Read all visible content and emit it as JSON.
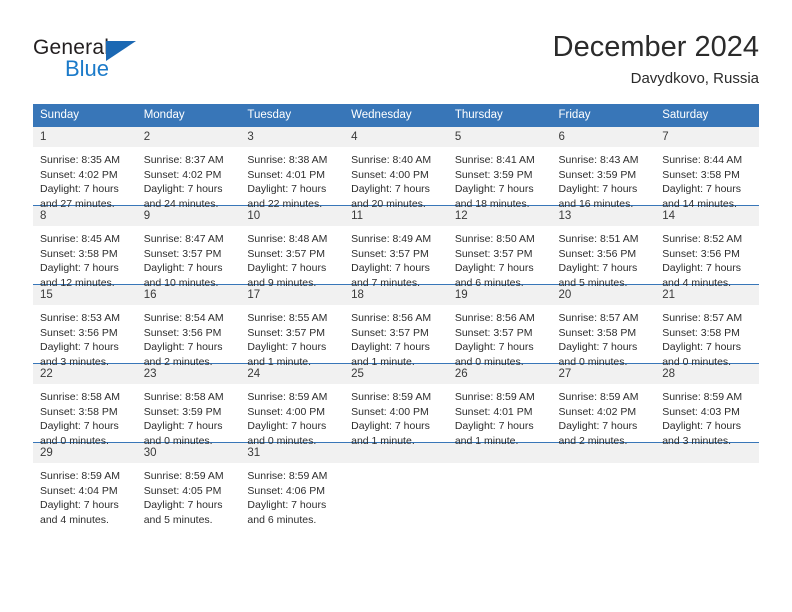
{
  "brand": {
    "name_top": "General",
    "name_bottom": "Blue",
    "accent_color": "#1b7ac9",
    "triangle_color": "#1b68b3"
  },
  "header": {
    "title": "December 2024",
    "subtitle": "Davydkovo, Russia"
  },
  "theme": {
    "header_blue": "#3876b8",
    "daynum_band": "#f1f1f1",
    "text": "#2d2d2d"
  },
  "weekday_headers": [
    "Sunday",
    "Monday",
    "Tuesday",
    "Wednesday",
    "Thursday",
    "Friday",
    "Saturday"
  ],
  "labels": {
    "sunrise_prefix": "Sunrise:",
    "sunset_prefix": "Sunset:",
    "daylight_prefix": "Daylight:"
  },
  "weeks": [
    [
      {
        "day": "1",
        "sunrise": "Sunrise: 8:35 AM",
        "sunset": "Sunset: 4:02 PM",
        "daylight1": "Daylight: 7 hours",
        "daylight2": "and 27 minutes."
      },
      {
        "day": "2",
        "sunrise": "Sunrise: 8:37 AM",
        "sunset": "Sunset: 4:02 PM",
        "daylight1": "Daylight: 7 hours",
        "daylight2": "and 24 minutes."
      },
      {
        "day": "3",
        "sunrise": "Sunrise: 8:38 AM",
        "sunset": "Sunset: 4:01 PM",
        "daylight1": "Daylight: 7 hours",
        "daylight2": "and 22 minutes."
      },
      {
        "day": "4",
        "sunrise": "Sunrise: 8:40 AM",
        "sunset": "Sunset: 4:00 PM",
        "daylight1": "Daylight: 7 hours",
        "daylight2": "and 20 minutes."
      },
      {
        "day": "5",
        "sunrise": "Sunrise: 8:41 AM",
        "sunset": "Sunset: 3:59 PM",
        "daylight1": "Daylight: 7 hours",
        "daylight2": "and 18 minutes."
      },
      {
        "day": "6",
        "sunrise": "Sunrise: 8:43 AM",
        "sunset": "Sunset: 3:59 PM",
        "daylight1": "Daylight: 7 hours",
        "daylight2": "and 16 minutes."
      },
      {
        "day": "7",
        "sunrise": "Sunrise: 8:44 AM",
        "sunset": "Sunset: 3:58 PM",
        "daylight1": "Daylight: 7 hours",
        "daylight2": "and 14 minutes."
      }
    ],
    [
      {
        "day": "8",
        "sunrise": "Sunrise: 8:45 AM",
        "sunset": "Sunset: 3:58 PM",
        "daylight1": "Daylight: 7 hours",
        "daylight2": "and 12 minutes."
      },
      {
        "day": "9",
        "sunrise": "Sunrise: 8:47 AM",
        "sunset": "Sunset: 3:57 PM",
        "daylight1": "Daylight: 7 hours",
        "daylight2": "and 10 minutes."
      },
      {
        "day": "10",
        "sunrise": "Sunrise: 8:48 AM",
        "sunset": "Sunset: 3:57 PM",
        "daylight1": "Daylight: 7 hours",
        "daylight2": "and 9 minutes."
      },
      {
        "day": "11",
        "sunrise": "Sunrise: 8:49 AM",
        "sunset": "Sunset: 3:57 PM",
        "daylight1": "Daylight: 7 hours",
        "daylight2": "and 7 minutes."
      },
      {
        "day": "12",
        "sunrise": "Sunrise: 8:50 AM",
        "sunset": "Sunset: 3:57 PM",
        "daylight1": "Daylight: 7 hours",
        "daylight2": "and 6 minutes."
      },
      {
        "day": "13",
        "sunrise": "Sunrise: 8:51 AM",
        "sunset": "Sunset: 3:56 PM",
        "daylight1": "Daylight: 7 hours",
        "daylight2": "and 5 minutes."
      },
      {
        "day": "14",
        "sunrise": "Sunrise: 8:52 AM",
        "sunset": "Sunset: 3:56 PM",
        "daylight1": "Daylight: 7 hours",
        "daylight2": "and 4 minutes."
      }
    ],
    [
      {
        "day": "15",
        "sunrise": "Sunrise: 8:53 AM",
        "sunset": "Sunset: 3:56 PM",
        "daylight1": "Daylight: 7 hours",
        "daylight2": "and 3 minutes."
      },
      {
        "day": "16",
        "sunrise": "Sunrise: 8:54 AM",
        "sunset": "Sunset: 3:56 PM",
        "daylight1": "Daylight: 7 hours",
        "daylight2": "and 2 minutes."
      },
      {
        "day": "17",
        "sunrise": "Sunrise: 8:55 AM",
        "sunset": "Sunset: 3:57 PM",
        "daylight1": "Daylight: 7 hours",
        "daylight2": "and 1 minute."
      },
      {
        "day": "18",
        "sunrise": "Sunrise: 8:56 AM",
        "sunset": "Sunset: 3:57 PM",
        "daylight1": "Daylight: 7 hours",
        "daylight2": "and 1 minute."
      },
      {
        "day": "19",
        "sunrise": "Sunrise: 8:56 AM",
        "sunset": "Sunset: 3:57 PM",
        "daylight1": "Daylight: 7 hours",
        "daylight2": "and 0 minutes."
      },
      {
        "day": "20",
        "sunrise": "Sunrise: 8:57 AM",
        "sunset": "Sunset: 3:58 PM",
        "daylight1": "Daylight: 7 hours",
        "daylight2": "and 0 minutes."
      },
      {
        "day": "21",
        "sunrise": "Sunrise: 8:57 AM",
        "sunset": "Sunset: 3:58 PM",
        "daylight1": "Daylight: 7 hours",
        "daylight2": "and 0 minutes."
      }
    ],
    [
      {
        "day": "22",
        "sunrise": "Sunrise: 8:58 AM",
        "sunset": "Sunset: 3:58 PM",
        "daylight1": "Daylight: 7 hours",
        "daylight2": "and 0 minutes."
      },
      {
        "day": "23",
        "sunrise": "Sunrise: 8:58 AM",
        "sunset": "Sunset: 3:59 PM",
        "daylight1": "Daylight: 7 hours",
        "daylight2": "and 0 minutes."
      },
      {
        "day": "24",
        "sunrise": "Sunrise: 8:59 AM",
        "sunset": "Sunset: 4:00 PM",
        "daylight1": "Daylight: 7 hours",
        "daylight2": "and 0 minutes."
      },
      {
        "day": "25",
        "sunrise": "Sunrise: 8:59 AM",
        "sunset": "Sunset: 4:00 PM",
        "daylight1": "Daylight: 7 hours",
        "daylight2": "and 1 minute."
      },
      {
        "day": "26",
        "sunrise": "Sunrise: 8:59 AM",
        "sunset": "Sunset: 4:01 PM",
        "daylight1": "Daylight: 7 hours",
        "daylight2": "and 1 minute."
      },
      {
        "day": "27",
        "sunrise": "Sunrise: 8:59 AM",
        "sunset": "Sunset: 4:02 PM",
        "daylight1": "Daylight: 7 hours",
        "daylight2": "and 2 minutes."
      },
      {
        "day": "28",
        "sunrise": "Sunrise: 8:59 AM",
        "sunset": "Sunset: 4:03 PM",
        "daylight1": "Daylight: 7 hours",
        "daylight2": "and 3 minutes."
      }
    ],
    [
      {
        "day": "29",
        "sunrise": "Sunrise: 8:59 AM",
        "sunset": "Sunset: 4:04 PM",
        "daylight1": "Daylight: 7 hours",
        "daylight2": "and 4 minutes."
      },
      {
        "day": "30",
        "sunrise": "Sunrise: 8:59 AM",
        "sunset": "Sunset: 4:05 PM",
        "daylight1": "Daylight: 7 hours",
        "daylight2": "and 5 minutes."
      },
      {
        "day": "31",
        "sunrise": "Sunrise: 8:59 AM",
        "sunset": "Sunset: 4:06 PM",
        "daylight1": "Daylight: 7 hours",
        "daylight2": "and 6 minutes."
      },
      {
        "day": "",
        "sunrise": "",
        "sunset": "",
        "daylight1": "",
        "daylight2": ""
      },
      {
        "day": "",
        "sunrise": "",
        "sunset": "",
        "daylight1": "",
        "daylight2": ""
      },
      {
        "day": "",
        "sunrise": "",
        "sunset": "",
        "daylight1": "",
        "daylight2": ""
      },
      {
        "day": "",
        "sunrise": "",
        "sunset": "",
        "daylight1": "",
        "daylight2": ""
      }
    ]
  ]
}
